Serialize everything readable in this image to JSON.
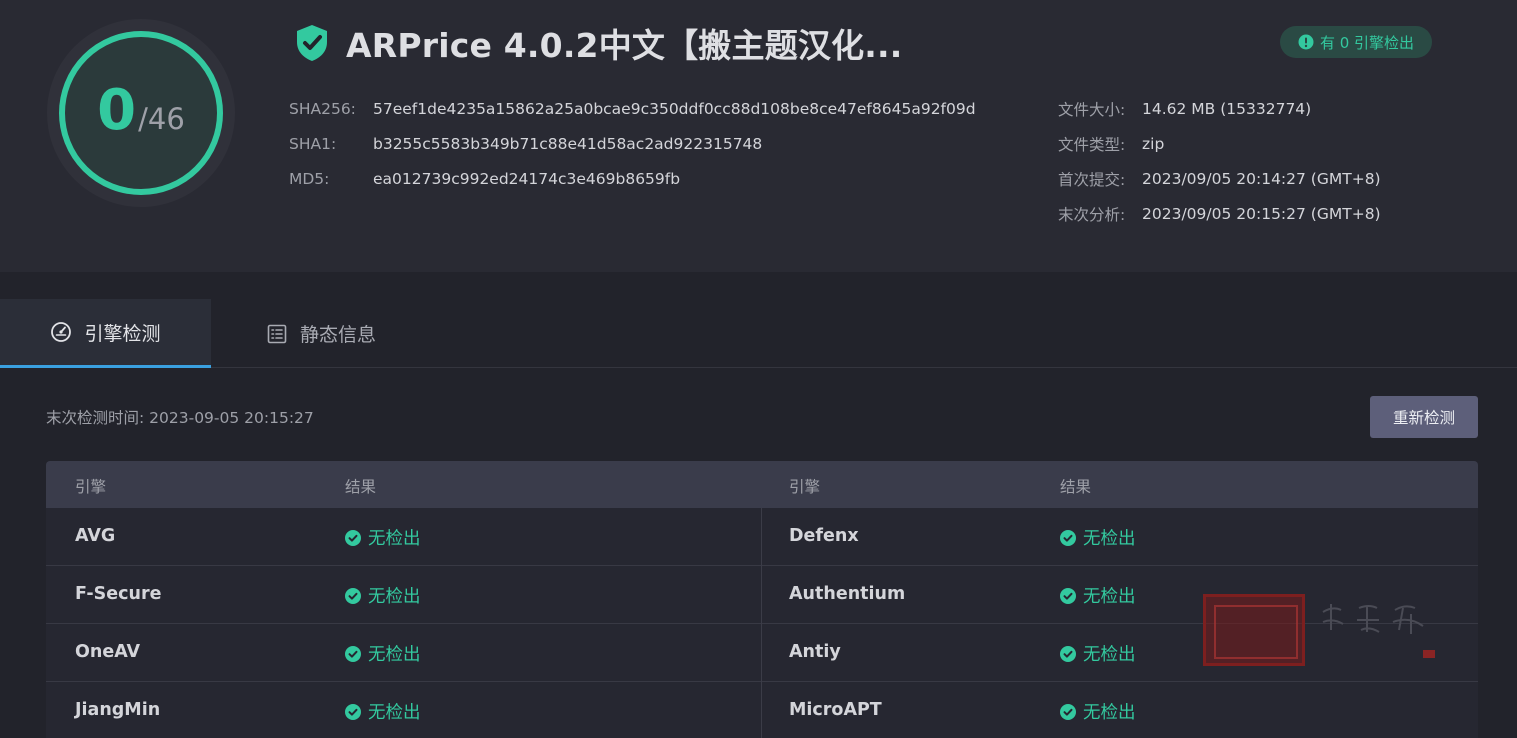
{
  "gauge": {
    "count": "0",
    "total": "/46"
  },
  "file": {
    "title": "ARPrice 4.0.2中文【搬主题汉化..."
  },
  "badge": {
    "label": "有 0 引擎检出"
  },
  "hashes": [
    {
      "label": "SHA256:",
      "value": "57eef1de4235a15862a25a0bcae9c350ddf0cc88d108be8ce47ef8645a92f09d"
    },
    {
      "label": "SHA1:",
      "value": "b3255c5583b349b71c88e41d58ac2ad922315748"
    },
    {
      "label": "MD5:",
      "value": "ea012739c992ed24174c3e469b8659fb"
    }
  ],
  "file_info": [
    {
      "label": "文件大小:",
      "value": "14.62 MB (15332774)"
    },
    {
      "label": "文件类型:",
      "value": "zip"
    },
    {
      "label": "首次提交:",
      "value": "2023/09/05 20:14:27 (GMT+8)"
    },
    {
      "label": "末次分析:",
      "value": "2023/09/05 20:15:27 (GMT+8)"
    }
  ],
  "tabs": [
    {
      "label": "引擎检测",
      "icon": "speedometer-icon",
      "active": true
    },
    {
      "label": "静态信息",
      "icon": "document-list-icon",
      "active": false
    }
  ],
  "scan": {
    "last_time": "末次检测时间: 2023-09-05 20:15:27",
    "rescan_label": "重新检测"
  },
  "table": {
    "headers": [
      "引擎",
      "结果",
      "引擎",
      "结果"
    ],
    "rows": [
      {
        "engine1": "AVG",
        "result1": "无检出",
        "engine2": "Defenx",
        "result2": "无检出"
      },
      {
        "engine1": "F-Secure",
        "result1": "无检出",
        "engine2": "Authentium",
        "result2": "无检出"
      },
      {
        "engine1": "OneAV",
        "result1": "无检出",
        "engine2": "Antiy",
        "result2": "无检出"
      },
      {
        "engine1": "JiangMin",
        "result1": "无检出",
        "engine2": "MicroAPT",
        "result2": "无检出"
      }
    ]
  },
  "colors": {
    "accent": "#33c99f",
    "tab_underline": "#3aa0e0",
    "button": "#5d5f7a",
    "background": "#22232b"
  },
  "watermark": {
    "text": "搬主题"
  }
}
